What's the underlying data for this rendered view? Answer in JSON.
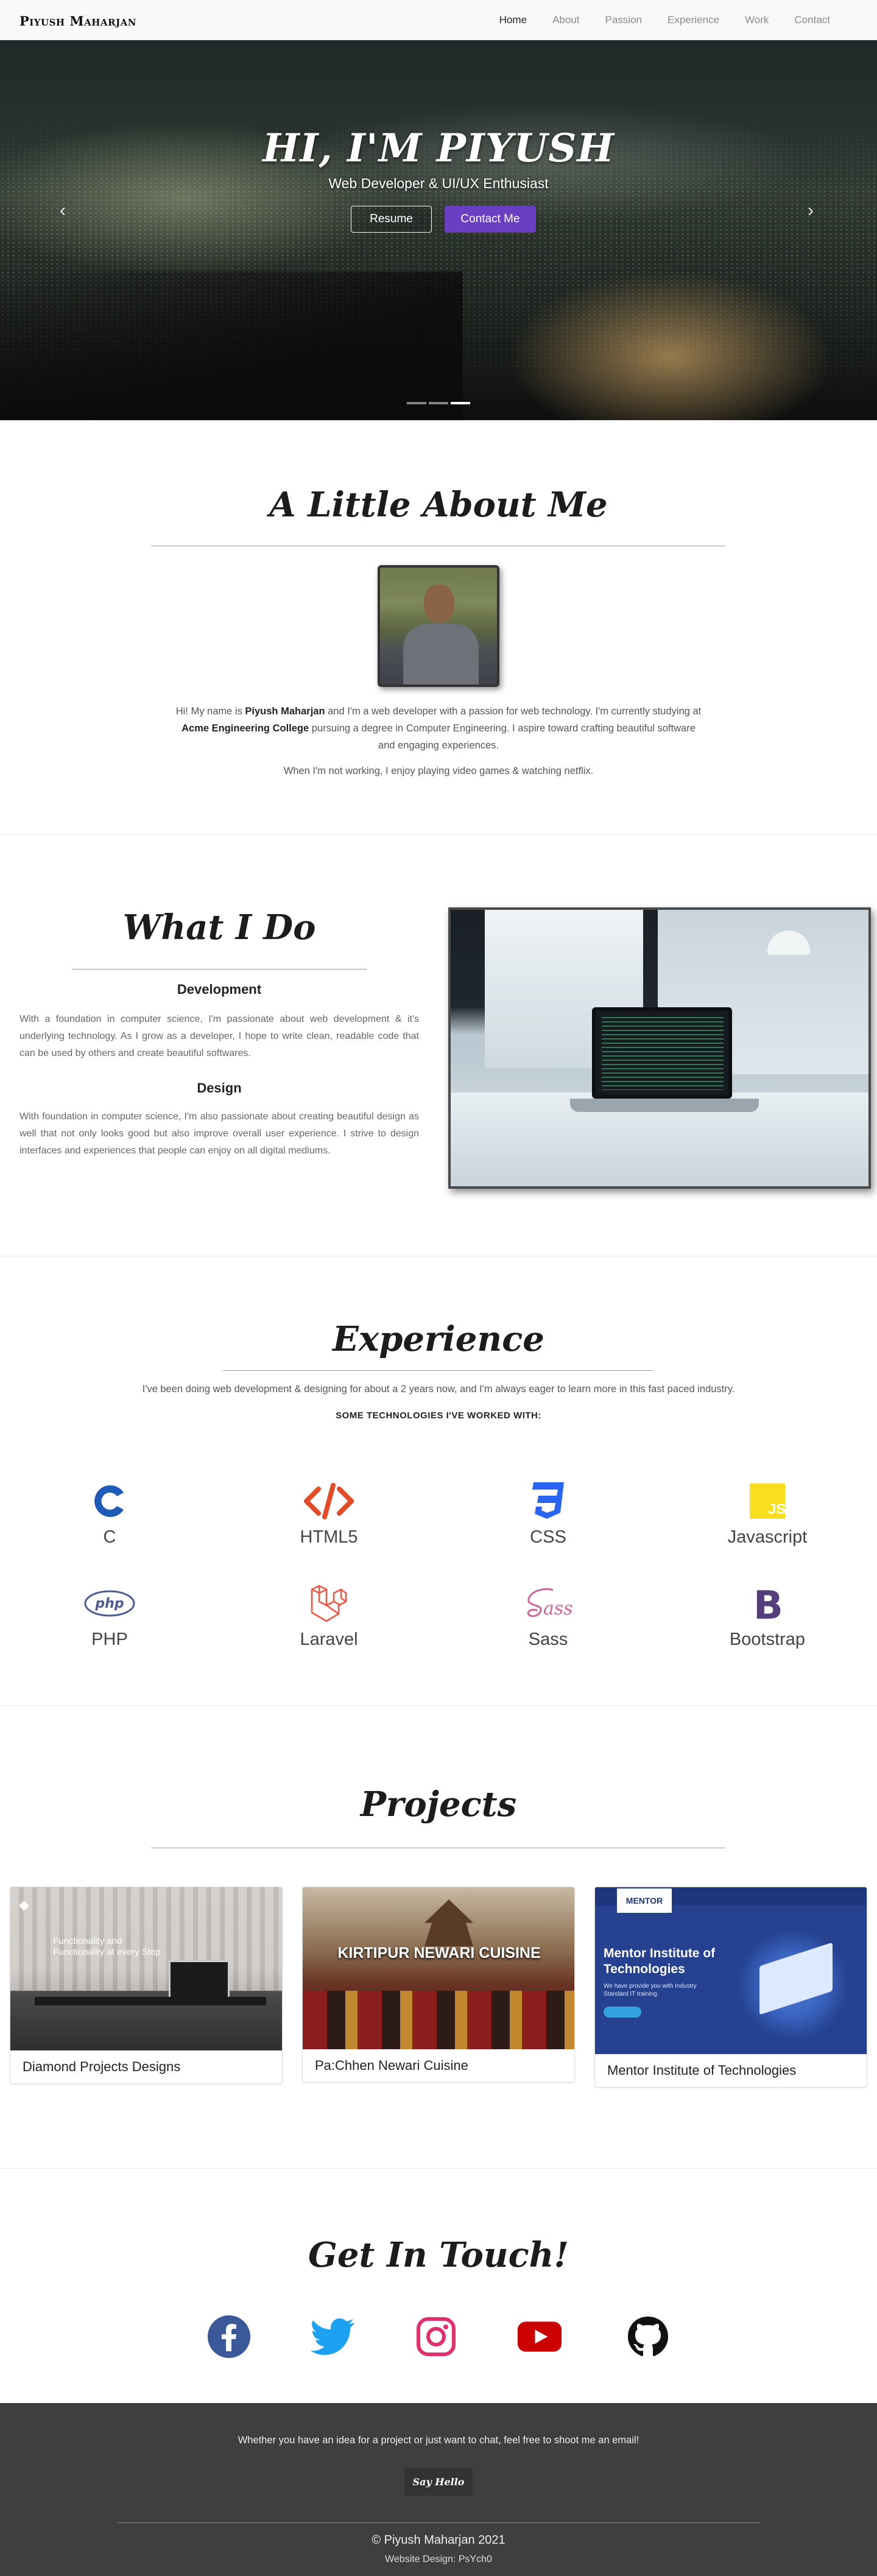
{
  "nav": {
    "brand": "Piyush Maharjan",
    "links": [
      "Home",
      "About",
      "Passion",
      "Experience",
      "Work",
      "Contact"
    ]
  },
  "hero": {
    "title": "HI, I'M PIYUSH",
    "subtitle": "Web Developer & UI/UX Enthusiast",
    "resume_label": "Resume",
    "contact_label": "Contact Me",
    "accent": "#6a3fc1"
  },
  "about": {
    "title": "A Little About Me",
    "p1_a": "Hi! My name is ",
    "p1_name": "Piyush Maharjan",
    "p1_b": " and I'm a web developer with a passion for web technology. I'm currently studying at",
    "p1_college": "Acme Engineering College",
    "p1_c": " pursuing a degree in Computer Engineering. I aspire toward crafting beautiful software",
    "p1_d": "and engaging experiences.",
    "p2": "When I'm not working, I enjoy playing video games & watching netflix."
  },
  "whatido": {
    "title": "What I Do",
    "dev_title": "Development",
    "dev_text": "With a foundation in computer science, I'm passionate about web development & it's underlying technology. As I grow as a developer, I hope to write clean, readable code that can be used by others and create beautiful softwares.",
    "design_title": "Design",
    "design_text": "With foundation in computer science, I'm also passionate about creating beautiful design as well that not only looks good but also improve overall user experience. I strive to design interfaces and experiences that people can enjoy on all digital mediums."
  },
  "experience": {
    "title": "Experience",
    "text": "I've been doing web development & designing for about a 2 years now, and I'm always eager to learn more in this fast paced industry.",
    "sub": "SOME TECHNOLOGIES I'VE WORKED WITH:",
    "techs": [
      {
        "name": "C",
        "icon": "c-icon",
        "color": "#283593"
      },
      {
        "name": "HTML5",
        "icon": "html5-icon",
        "color": "#e34c26"
      },
      {
        "name": "CSS",
        "icon": "css3-icon",
        "color": "#2965f1"
      },
      {
        "name": "Javascript",
        "icon": "javascript-icon",
        "color": "#f7df1e"
      },
      {
        "name": "PHP",
        "icon": "php-icon",
        "color": "#4f5b93"
      },
      {
        "name": "Laravel",
        "icon": "laravel-icon",
        "color": "#f05340"
      },
      {
        "name": "Sass",
        "icon": "sass-icon",
        "color": "#cd6799"
      },
      {
        "name": "Bootstrap",
        "icon": "bootstrap-icon",
        "color": "#563d7c"
      }
    ]
  },
  "projects": {
    "title": "Projects",
    "items": [
      {
        "name": "Diamond Projects Designs",
        "overlay": "Functionality and Functionality at every Step"
      },
      {
        "name": "Pa:Chhen Newari Cuisine",
        "overlay": "KIRTIPUR NEWARI CUISINE"
      },
      {
        "name": "Mentor Institute of Technologies",
        "overlay_title": "Mentor Institute of Technologies",
        "overlay_sub": "We have provide you with Industry Standard IT training.",
        "logo": "MENTOR"
      }
    ]
  },
  "contact": {
    "title": "Get In Touch!",
    "socials": [
      {
        "icon": "facebook-icon",
        "color": "#3b5998"
      },
      {
        "icon": "twitter-icon",
        "color": "#1da1f2"
      },
      {
        "icon": "instagram-icon",
        "color": "#e1306c"
      },
      {
        "icon": "youtube-icon",
        "color": "#cc0000"
      },
      {
        "icon": "github-icon",
        "color": "#111111"
      }
    ]
  },
  "footer": {
    "text": "Whether you have an idea for a project or just want to chat, feel free to shoot me an email!",
    "button": "Say Hello",
    "copyright": "© Piyush Maharjan 2021",
    "design": "Website Design: PsYch0"
  }
}
